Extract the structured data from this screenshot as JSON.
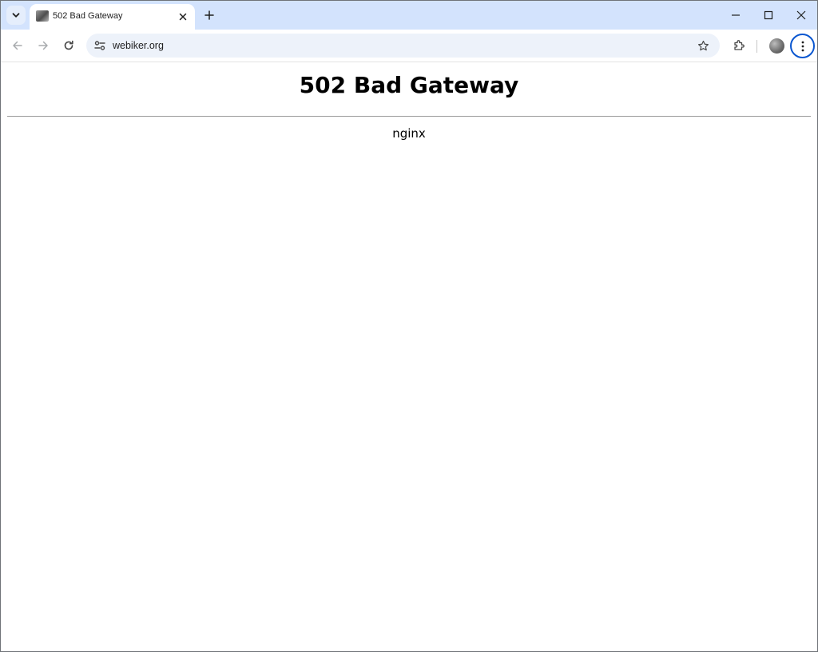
{
  "browser": {
    "tab": {
      "title": "502 Bad Gateway"
    },
    "address_bar": {
      "url": "webiker.org"
    },
    "icons": {
      "tab_search": "chevron-down-icon",
      "tab_close": "close-icon",
      "new_tab": "plus-icon",
      "minimize": "minimize-icon",
      "maximize": "maximize-icon",
      "close_window": "close-icon",
      "back": "arrow-left-icon",
      "forward": "arrow-right-icon",
      "reload": "reload-icon",
      "site_info": "tune-icon",
      "bookmark": "star-icon",
      "extensions": "puzzle-icon",
      "menu": "kebab-menu-icon"
    },
    "colors": {
      "tabstrip": "#d3e3fd",
      "omnibox": "#edf2fa",
      "focus_ring": "#0b57d0"
    }
  },
  "page": {
    "heading": "502 Bad Gateway",
    "server": "nginx"
  }
}
